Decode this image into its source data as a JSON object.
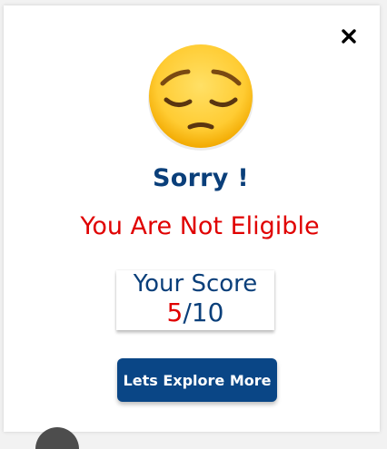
{
  "dialog": {
    "emoji": "pensive-face-icon",
    "title": "Sorry !",
    "message": "You Are Not Eligible",
    "score_label": "Your Score",
    "score_value": "5",
    "score_total": "/10",
    "button_label": "Lets Explore More",
    "close_icon": "close-icon"
  },
  "colors": {
    "primary": "#0a3f7a",
    "button": "#0a4686",
    "error": "#e00000",
    "emoji_face": "#ffcc33"
  }
}
